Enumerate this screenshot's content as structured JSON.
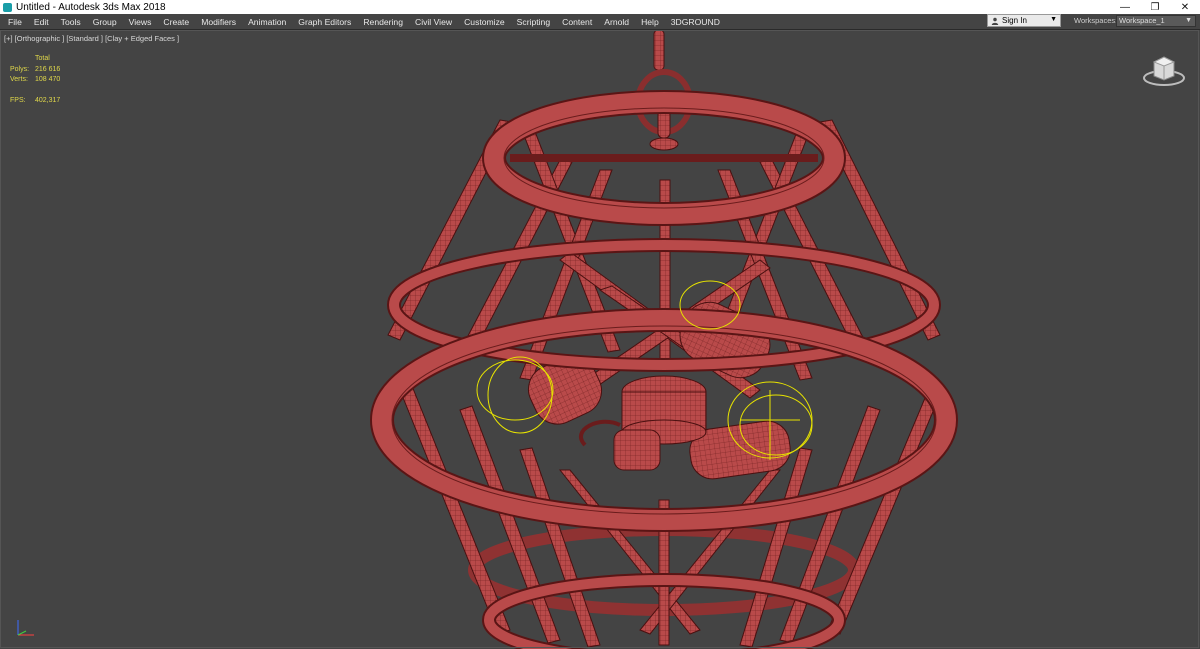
{
  "window": {
    "title": "Untitled - Autodesk 3ds Max 2018",
    "controls": [
      "—",
      "❐",
      "✕"
    ]
  },
  "menu": {
    "items": [
      "File",
      "Edit",
      "Tools",
      "Group",
      "Views",
      "Create",
      "Modifiers",
      "Animation",
      "Graph Editors",
      "Rendering",
      "Civil View",
      "Customize",
      "Scripting",
      "Content",
      "Arnold",
      "Help",
      "3DGROUND"
    ]
  },
  "signin": {
    "label": "Sign In"
  },
  "workspaces": {
    "label": "Workspaces:",
    "value": "Workspace_1"
  },
  "viewport": {
    "label": "[+] [Orthographic ] [Standard ] [Clay + Edged Faces ]",
    "stats": {
      "header": "Total",
      "polys_label": "Polys:",
      "polys_value": "216 616",
      "verts_label": "Verts:",
      "verts_value": "108 470",
      "fps_label": "FPS:",
      "fps_value": "402,317"
    }
  },
  "colors": {
    "mesh_fill": "#b94a4a",
    "mesh_edge": "#5a1515",
    "selection": "#e7e300",
    "viewport_bg": "#444444"
  },
  "icons": {
    "app": "3ds-max-logo-icon",
    "user": "user-icon",
    "viewcube": "viewcube-icon",
    "axis": "axis-tripod-icon"
  }
}
